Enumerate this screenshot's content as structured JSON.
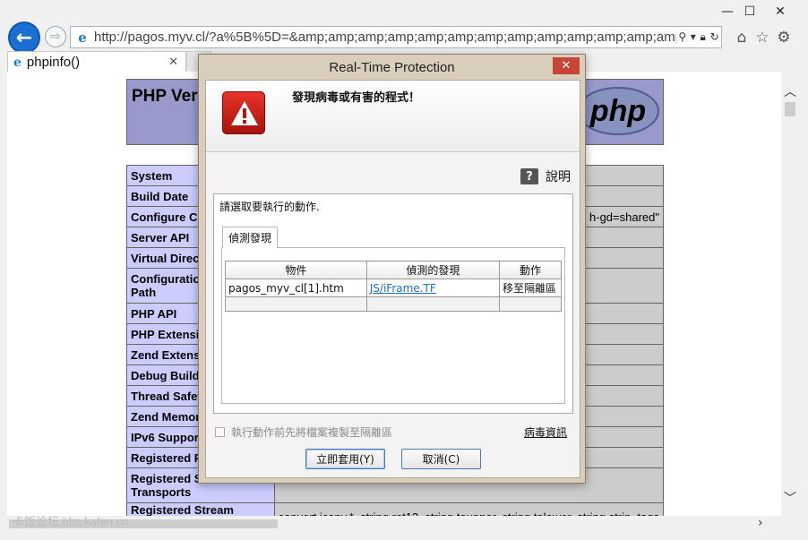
{
  "browser": {
    "url": "http://pagos.myv.cl/?a%5B%5D=&amp;amp;amp;amp;amp;amp;amp;amp;amp;amp;amp;amp;amp;an",
    "tab_title": "phpinfo()",
    "window_controls": [
      "minimize",
      "maximize",
      "close"
    ],
    "toolbar_icons": [
      "home-icon",
      "star-icon",
      "gear-icon"
    ]
  },
  "page": {
    "header_title": "PHP Vers",
    "logo_text": "php",
    "rows": [
      {
        "key": "System",
        "value": ""
      },
      {
        "key": "Build Date",
        "value": ""
      },
      {
        "key": "Configure Co",
        "value": "h-gd=shared\""
      },
      {
        "key": "Server API",
        "value": ""
      },
      {
        "key": "Virtual Direct",
        "value": ""
      },
      {
        "key": "Configuration\nPath",
        "value": ""
      },
      {
        "key": "PHP API",
        "value": ""
      },
      {
        "key": "PHP Extensio",
        "value": ""
      },
      {
        "key": "Zend Extensi",
        "value": ""
      },
      {
        "key": "Debug Build",
        "value": ""
      },
      {
        "key": "Thread Safety",
        "value": ""
      },
      {
        "key": "Zend Memory",
        "value": ""
      },
      {
        "key": "IPv6 Support",
        "value": ""
      },
      {
        "key": "Registered PH",
        "value": ""
      },
      {
        "key": "Registered St\nTransports",
        "value": ""
      },
      {
        "key": "Registered Stream Filters",
        "value": "convert.iconv.*, string.rot13, string.toupper, string.tolower, string.strip_tags"
      }
    ],
    "watermark": "卡饭论坛 bbs.kafan.cn"
  },
  "dialog": {
    "title": "Real-Time Protection",
    "close_label": "✕",
    "banner_text": "發現病毒或有害的程式！",
    "help_icon": "?",
    "help_label": "說明",
    "prompt": "請選取要執行的動作.",
    "tab_label": "偵測發現",
    "table": {
      "headers": [
        "物件",
        "偵測的發現",
        "動作"
      ],
      "rows": [
        {
          "object": "pagos_myv_cl[1].htm",
          "detection": "JS/iFrame.TF",
          "action": "移至隔離區"
        }
      ]
    },
    "checkbox_label": "執行動作前先將檔案複製至隔離區",
    "checkbox_checked": false,
    "virus_info_link": "病毒資訊",
    "apply_button": "立即套用(Y)",
    "cancel_button": "取消(C)"
  }
}
